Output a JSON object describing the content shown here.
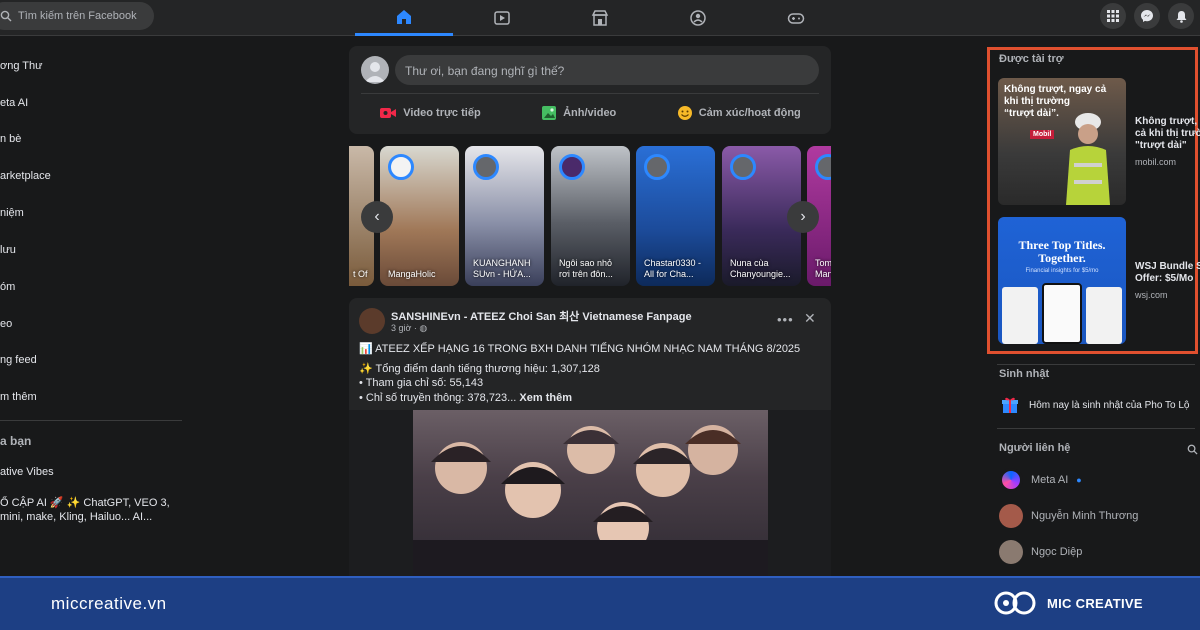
{
  "topbar": {
    "search_placeholder": "Tìm kiếm trên Facebook",
    "tabs": [
      "home-icon",
      "video-icon",
      "marketplace-icon",
      "groups-icon",
      "gaming-icon"
    ]
  },
  "left_nav": {
    "items": [
      "ơng Thư",
      "eta AI",
      "n bè",
      "arketplace",
      "niệm",
      "lưu",
      "óm",
      "eo",
      "ng feed",
      "m thêm"
    ],
    "section_title": "a bạn",
    "shortcuts": [
      "ative Vibes",
      "Ổ CẬP AI 🚀 ✨ ChatGPT, VEO 3,",
      "mini, make, Kling, Hailuo... AI..."
    ]
  },
  "composer": {
    "placeholder": "Thư ơi, bạn đang nghĩ gì thế?",
    "actions": [
      "Video trực tiếp",
      "Ảnh/video",
      "Cảm xúc/hoạt động"
    ]
  },
  "stories": [
    {
      "name": "t Of"
    },
    {
      "name": "MangaHolic"
    },
    {
      "name": "KUANGHANH SUvn - HỨA..."
    },
    {
      "name": "Ngôi sao nhỏ rơi trên đôn..."
    },
    {
      "name": "Chastar0330 - All for Cha..."
    },
    {
      "name": "Nuna cùa Chanyoungie..."
    },
    {
      "name": "Tom Man"
    }
  ],
  "post": {
    "author": "SANSHINEvn - ATEEZ Choi San 최산 Vietnamese Fanpage",
    "time": "3 giờ · ",
    "headline": "📊 ATEEZ XẾP HẠNG 16 TRONG BXH DANH TIẾNG NHÓM NHẠC NAM THÁNG 8/2025",
    "lines": [
      "✨ Tổng điểm danh tiếng thương hiệu: 1,307,128",
      "• Tham gia chỉ số: 55,143",
      "• Chỉ số truyền thông: 378,723..."
    ],
    "see_more": "Xem thêm"
  },
  "sponsored": {
    "title": "Được tài trợ",
    "ads": [
      {
        "title_lines": [
          "Không trượt, ngay",
          "cả khi thị trườ",
          "\"trượt dài\""
        ],
        "domain": "mobil.com",
        "img_text": [
          "Không trượt, ngay cả",
          "khi thị trường",
          "“trượt dài”."
        ],
        "img_brand": "Mobil"
      },
      {
        "title_lines": [
          "WSJ Bundle S",
          "Offer: $5/Mo"
        ],
        "domain": "wsj.com",
        "img_text": [
          "Three Top Titles.",
          "Together."
        ],
        "img_sub": "Financial insights for $5/mo"
      }
    ]
  },
  "birthdays": {
    "title": "Sinh nhật",
    "text": "Hôm nay là sinh nhật của Pho To Lộ"
  },
  "contacts": {
    "title": "Người liên hệ",
    "items": [
      "Meta AI",
      "Nguyễn Minh Thương",
      "Ngọc Diệp"
    ]
  },
  "footer": {
    "site": "miccreative.vn",
    "brand": "MIC CREATIVE"
  }
}
